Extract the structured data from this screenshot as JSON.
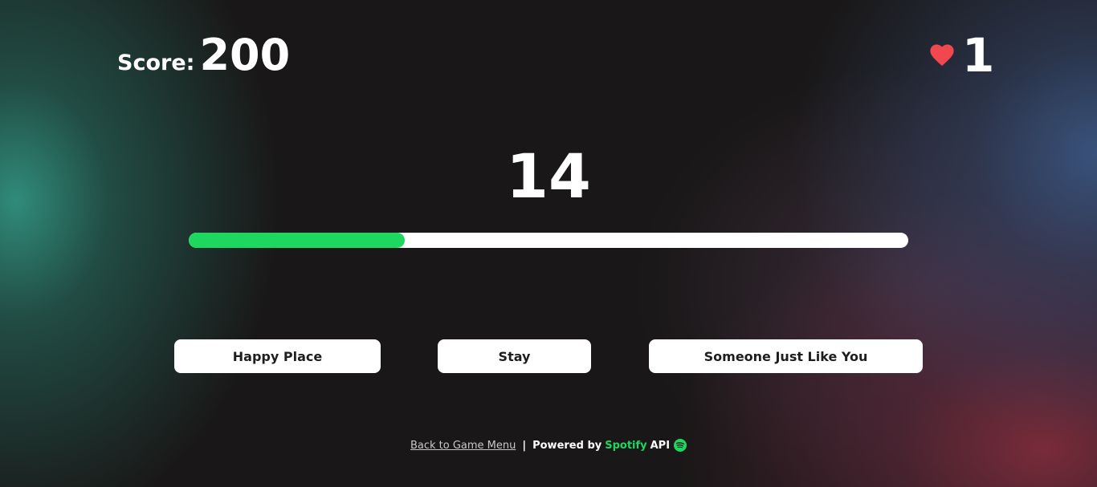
{
  "hud": {
    "score_label": "Score:",
    "score_value": "200",
    "lives_value": "1",
    "lives_icon": "heart-icon"
  },
  "round": {
    "timer_value": "14",
    "progress_fraction": 0.3
  },
  "answers": [
    {
      "label": "Happy Place"
    },
    {
      "label": "Stay"
    },
    {
      "label": "Someone Just Like You"
    }
  ],
  "footer": {
    "back_link": "Back to Game Menu",
    "separator": "|",
    "powered_by": "Powered by",
    "brand": "Spotify",
    "api": "API",
    "brand_icon": "spotify-icon"
  },
  "colors": {
    "accent_green": "#1ed760",
    "heart_red": "#f0484e",
    "button_bg": "#ffffff"
  }
}
